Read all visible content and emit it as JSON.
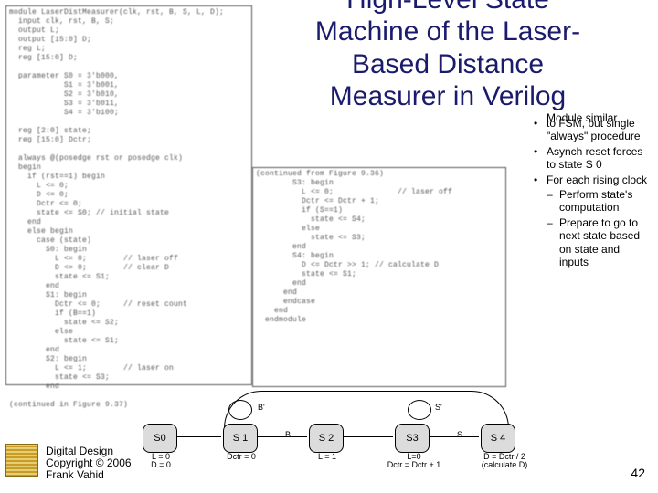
{
  "title": "High-Level State Machine of the Laser-Based Distance Measurer in Verilog",
  "title_lines": {
    "l1": "High-Level State",
    "l2": "Machine of the Laser-",
    "l3": "Based Distance",
    "l4": "Measurer in Verilog"
  },
  "notes": {
    "overlay": "Module similar",
    "b1_rest": "to FSM, but single \"always\" procedure",
    "b2": "Asynch reset forces to state S 0",
    "b3": "For each rising clock",
    "s1": "Perform state's computation",
    "s2": "Prepare to go to next state based on state and inputs"
  },
  "code_left": "module LaserDistMeasurer(clk, rst, B, S, L, D);\n  input clk, rst, B, S;\n  output L;\n  output [15:0] D;\n  reg L;\n  reg [15:0] D;\n\n  parameter S0 = 3'b000,\n            S1 = 3'b001,\n            S2 = 3'b010,\n            S3 = 3'b011,\n            S4 = 3'b100;\n\n  reg [2:0] state;\n  reg [15:0] Dctr;\n\n  always @(posedge rst or posedge clk)\n  begin\n    if (rst==1) begin\n      L <= 0;\n      D <= 0;\n      Dctr <= 0;\n      state <= S0; // initial state\n    end\n    else begin\n      case (state)\n        S0: begin\n          L <= 0;        // laser off\n          D <= 0;        // clear D\n          state <= S1;\n        end\n        S1: begin\n          Dctr <= 0;     // reset count\n          if (B==1)\n            state <= S2;\n          else\n            state <= S1;\n        end\n        S2: begin\n          L <= 1;        // laser on\n          state <= S3;\n        end\n\n(continued in Figure 9.37)",
  "code_right": "(continued from Figure 9.36)\n        S3: begin\n          L <= 0;              // laser off\n          Dctr <= Dctr + 1;\n          if (S==1)\n            state <= S4;\n          else\n            state <= S3;\n        end\n        S4: begin\n          D <= Dctr >> 1; // calculate D\n          state <= S1;\n        end\n      end\n      endcase\n    end\n  endmodule",
  "states": {
    "s0": "S0",
    "s1": "S 1",
    "s2": "S 2",
    "s3": "S3",
    "s4": "S 4"
  },
  "state_sub": {
    "s0": "L = 0\nD = 0",
    "s1": "Dctr = 0",
    "s2": "L = 1",
    "s3": "L=0\nDctr = Dctr + 1",
    "s4": "D = Dctr / 2\n(calculate D)"
  },
  "edge_labels": {
    "bprime": "B'",
    "b": "B",
    "sprime": "S'",
    "s": "S"
  },
  "footer": {
    "l1": "Digital Design",
    "l2": "Copyright © 2006",
    "l3": "Frank Vahid"
  },
  "page_number": "42"
}
